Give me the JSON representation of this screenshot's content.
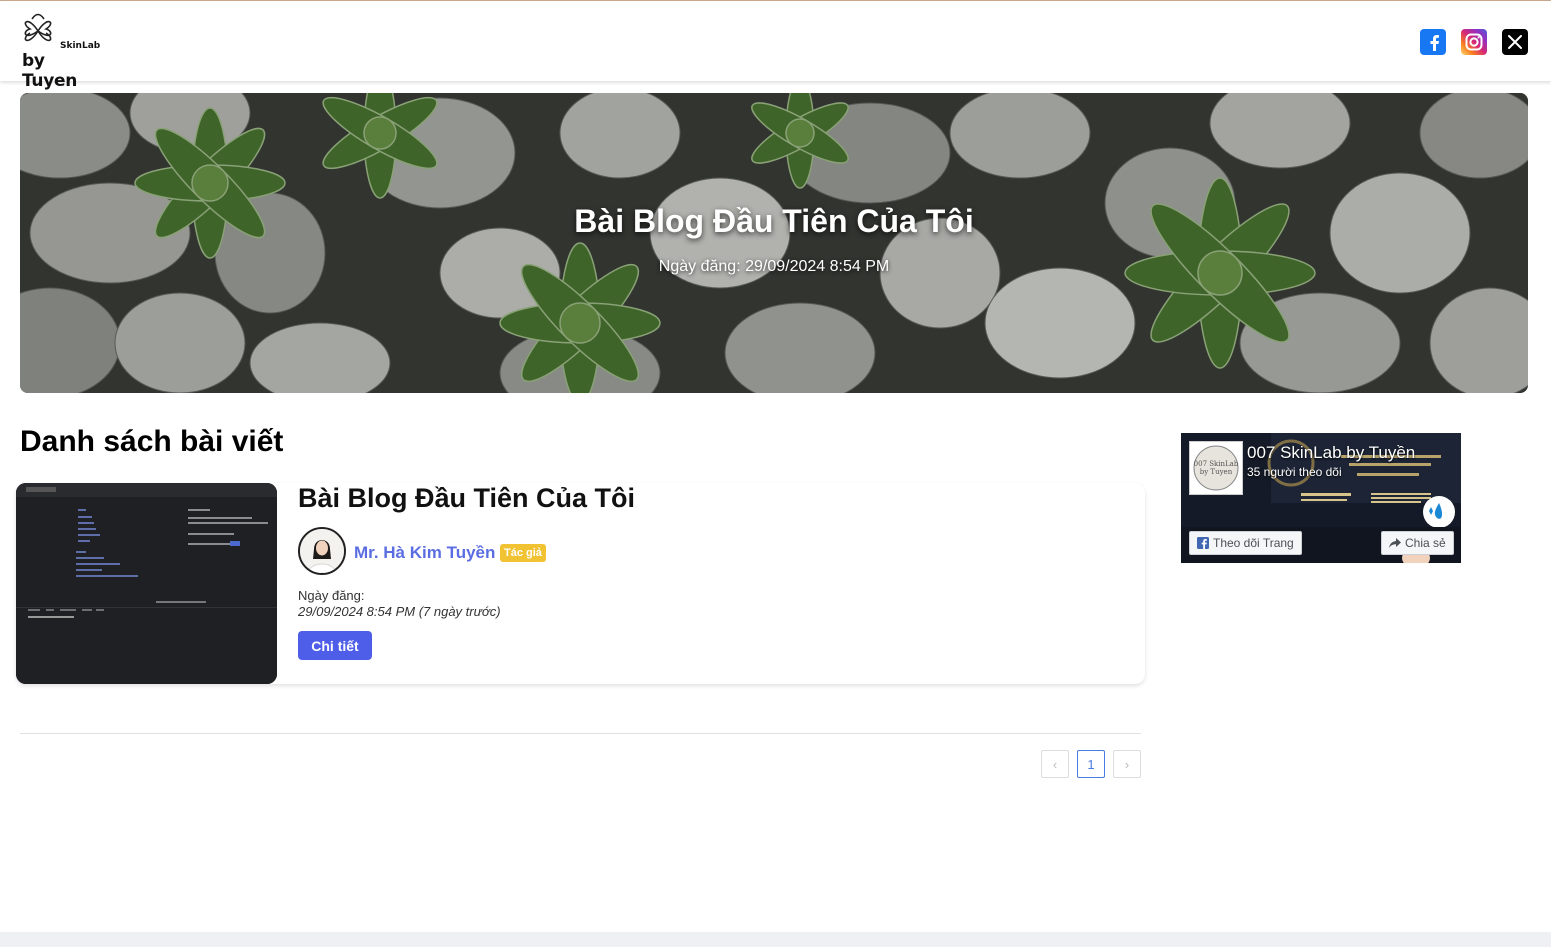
{
  "header": {
    "logo_small": "SkinLab",
    "logo_big": "by Tuyen",
    "social": [
      {
        "name": "facebook-icon",
        "color": "#1877f2"
      },
      {
        "name": "instagram-icon",
        "color": "#d62976"
      },
      {
        "name": "x-icon",
        "color": "#000000",
        "glyph": "𝕏"
      }
    ]
  },
  "hero": {
    "title": "Bài Blog Đầu Tiên Của Tôi",
    "date": "Ngày đăng: 29/09/2024 8:54 PM"
  },
  "main": {
    "section_title": "Danh sách bài viết",
    "posts": [
      {
        "title": "Bài Blog Đầu Tiên Của Tôi",
        "author": "Mr. Hà Kim Tuyền",
        "badge": "Tác giả",
        "date_label": "Ngày đăng:",
        "date_value": "29/09/2024 8:54 PM (7 ngày trước)",
        "button": "Chi tiết"
      }
    ],
    "pagination": {
      "prev": "‹",
      "pages": [
        "1"
      ],
      "next": "›"
    }
  },
  "facebook_widget": {
    "page_name": "007 SkinLab by Tuyền",
    "followers": "35 người theo dõi",
    "follow_button": "Theo dõi Trang",
    "share_button": "Chia sẻ"
  },
  "colors": {
    "accent": "#4f5ee8",
    "author": "#5b6ee1",
    "badge": "#f1c232"
  }
}
